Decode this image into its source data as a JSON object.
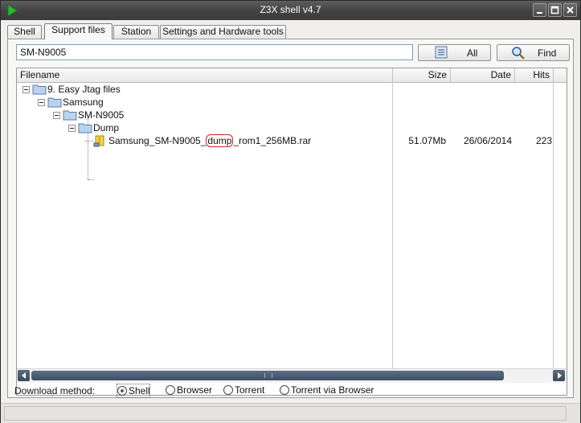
{
  "window": {
    "title": "Z3X shell v4.7"
  },
  "tabs": [
    {
      "label": "Shell"
    },
    {
      "label": "Support files"
    },
    {
      "label": "Station"
    },
    {
      "label": "Settings and Hardware tools"
    }
  ],
  "active_tab": "Support files",
  "search": {
    "value": "SM-N9005"
  },
  "buttons": {
    "all_label": "All",
    "find_label": "Find"
  },
  "grid": {
    "columns": {
      "filename": "Filename",
      "size": "Size",
      "date": "Date",
      "hits": "Hits"
    },
    "tree": [
      {
        "label": "9. Easy Jtag files",
        "type": "folder"
      },
      {
        "label": "Samsung",
        "type": "folder"
      },
      {
        "label": "SM-N9005",
        "type": "folder"
      },
      {
        "label": "Dump",
        "type": "folder"
      },
      {
        "type": "file",
        "name_prefix": "Samsung_SM-N9005_",
        "name_highlight": "dump",
        "name_suffix": "_rom1_256MB.rar",
        "size": "51.07Mb",
        "date": "26/06/2014",
        "hits": "223"
      }
    ]
  },
  "download": {
    "label": "Download method:",
    "options": [
      {
        "label": "Shell",
        "selected": true
      },
      {
        "label": "Browser",
        "selected": false
      },
      {
        "label": "Torrent",
        "selected": false
      },
      {
        "label": "Torrent via Browser",
        "selected": false
      }
    ]
  },
  "icons": {
    "app": "play-icon",
    "all_button": "list-icon",
    "find_button": "magnifier-icon"
  },
  "colors": {
    "titlebar": "#444444",
    "highlight_border": "#cc2222",
    "scrollbar": "#3e4f63",
    "app_icon": "#2eb82e"
  }
}
